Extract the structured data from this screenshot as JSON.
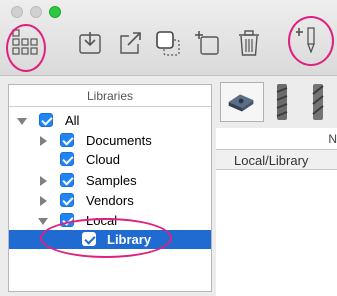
{
  "sidebar": {
    "header": "Libraries",
    "items": [
      {
        "label": "All",
        "expanded": true,
        "checked": true
      },
      {
        "label": "Documents",
        "expanded": false,
        "checked": true
      },
      {
        "label": "Cloud",
        "checked": true
      },
      {
        "label": "Samples",
        "expanded": false,
        "checked": true
      },
      {
        "label": "Vendors",
        "expanded": false,
        "checked": true
      },
      {
        "label": "Local",
        "expanded": true,
        "checked": true
      },
      {
        "label": "Library",
        "checked": true,
        "selected": true
      }
    ]
  },
  "content": {
    "column_header": "N",
    "path_label": "Local/Library"
  },
  "colors": {
    "selection": "#1f6bd1",
    "checkbox": "#1f85f5",
    "annotation": "#e0207f",
    "traffic_green": "#2bc840"
  }
}
